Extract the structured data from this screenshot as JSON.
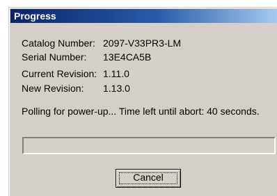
{
  "window": {
    "title": "Progress"
  },
  "fields": {
    "catalog_number_label": "Catalog Number:",
    "catalog_number_value": "2097-V33PR3-LM",
    "serial_number_label": "Serial Number:",
    "serial_number_value": "13E4CA5B",
    "current_revision_label": "Current Revision:",
    "current_revision_value": "1.11.0",
    "new_revision_label": "New Revision:",
    "new_revision_value": "1.13.0"
  },
  "status": {
    "message": "Polling for power-up... Time left until abort: 40 seconds."
  },
  "progress": {
    "fraction": 0
  },
  "buttons": {
    "cancel_label": "Cancel"
  },
  "colors": {
    "titlebar_start": "#0a246a",
    "titlebar_end": "#a6caf0",
    "dialog_background": "#d4d0c8"
  }
}
